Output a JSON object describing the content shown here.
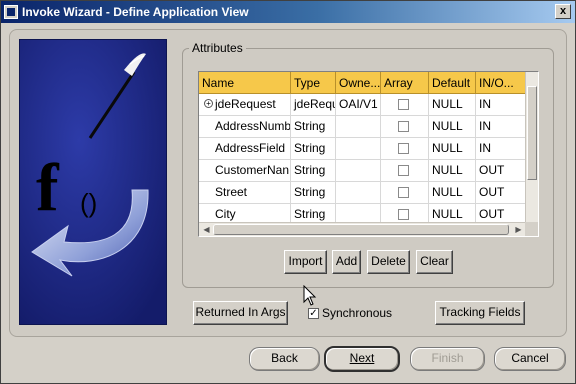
{
  "window": {
    "title": "Invoke Wizard - Define Application View",
    "close_label": "x"
  },
  "attributes": {
    "legend": "Attributes",
    "columns": [
      "Name",
      "Type",
      "Owne...",
      "Array",
      "Default",
      "IN/O..."
    ],
    "rows": [
      {
        "name": "jdeRequest",
        "type": "jdeRequ",
        "owner": "OAI/V1",
        "array": false,
        "default": "NULL",
        "inout": "IN"
      },
      {
        "name": "AddressNumb",
        "type": "String",
        "owner": "",
        "array": false,
        "default": "NULL",
        "inout": "IN"
      },
      {
        "name": "AddressField",
        "type": "String",
        "owner": "",
        "array": false,
        "default": "NULL",
        "inout": "IN"
      },
      {
        "name": "CustomerNan",
        "type": "String",
        "owner": "",
        "array": false,
        "default": "NULL",
        "inout": "OUT"
      },
      {
        "name": "Street",
        "type": "String",
        "owner": "",
        "array": false,
        "default": "NULL",
        "inout": "OUT"
      },
      {
        "name": "City",
        "type": "String",
        "owner": "",
        "array": false,
        "default": "NULL",
        "inout": "OUT"
      }
    ],
    "buttons": {
      "import": "Import",
      "add": "Add",
      "delete": "Delete",
      "clear": "Clear"
    }
  },
  "options": {
    "returned_in_args": "Returned In Args",
    "synchronous": {
      "label": "Synchronous",
      "checked": true
    },
    "tracking_fields": "Tracking Fields"
  },
  "footer": {
    "back": "Back",
    "next": "Next",
    "finish": "Finish",
    "cancel": "Cancel"
  },
  "colors": {
    "title_bar": "#0a246a",
    "header_row": "#f6c84a",
    "image_bg": "#1f2a86"
  }
}
